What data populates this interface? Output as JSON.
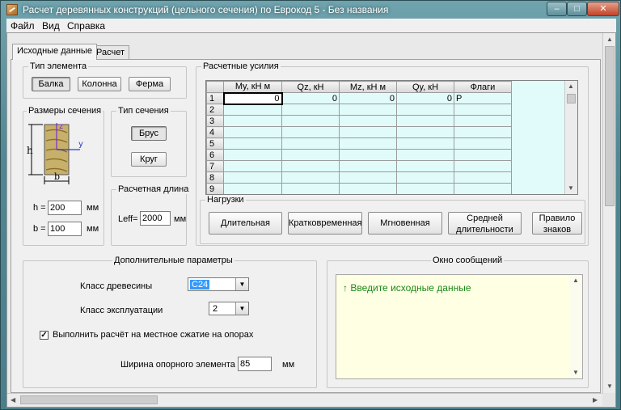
{
  "window": {
    "title": "Расчет деревянных конструкций (цельного сечения) по Еврокод 5 - Без названия",
    "minimize_icon": "minimize-icon",
    "maximize_icon": "maximize-icon",
    "close_icon": "close-icon",
    "minimize_glyph": "–",
    "maximize_glyph": "□",
    "close_glyph": "✕"
  },
  "menu": {
    "items": [
      {
        "label": "Файл"
      },
      {
        "label": "Вид"
      },
      {
        "label": "Справка"
      }
    ]
  },
  "tabs": [
    {
      "label": "Исходные данные",
      "active": true
    },
    {
      "label": "Расчет",
      "active": false
    }
  ],
  "element_type": {
    "legend": "Тип элемента",
    "buttons": [
      "Балка",
      "Колонна",
      "Ферма"
    ],
    "selected": "Балка"
  },
  "section_sizes": {
    "legend": "Размеры сечения",
    "diagram": {
      "h": "h",
      "b": "b",
      "z": "z",
      "y": "y"
    },
    "h_label": "h =",
    "h_value": "200",
    "h_unit": "мм",
    "b_label": "b =",
    "b_value": "100",
    "b_unit": "мм"
  },
  "section_type": {
    "legend": "Тип сечения",
    "buttons": [
      "Брус",
      "Круг"
    ],
    "selected": "Брус"
  },
  "design_length": {
    "legend": "Расчетная длина",
    "label": "Leff=",
    "value": "2000",
    "unit": "мм"
  },
  "forces": {
    "legend": "Расчетные усилия",
    "columns": [
      "My, кН м",
      "Qz, кН",
      "Mz, кН м",
      "Qy, кН",
      "Флаги"
    ],
    "rows": [
      {
        "n": "1",
        "cells": [
          "0",
          "0",
          "0",
          "0",
          "P"
        ]
      },
      {
        "n": "2",
        "cells": [
          "",
          "",
          "",
          "",
          ""
        ]
      },
      {
        "n": "3",
        "cells": [
          "",
          "",
          "",
          "",
          ""
        ]
      },
      {
        "n": "4",
        "cells": [
          "",
          "",
          "",
          "",
          ""
        ]
      },
      {
        "n": "5",
        "cells": [
          "",
          "",
          "",
          "",
          ""
        ]
      },
      {
        "n": "6",
        "cells": [
          "",
          "",
          "",
          "",
          ""
        ]
      },
      {
        "n": "7",
        "cells": [
          "",
          "",
          "",
          "",
          ""
        ]
      },
      {
        "n": "8",
        "cells": [
          "",
          "",
          "",
          "",
          ""
        ]
      },
      {
        "n": "9",
        "cells": [
          "",
          "",
          "",
          "",
          ""
        ]
      }
    ],
    "scroll_up": "▲",
    "scroll_down": "▼"
  },
  "loads": {
    "legend": "Нагрузки",
    "buttons": [
      {
        "label": "Длительная"
      },
      {
        "label": "Кратковременная"
      },
      {
        "label": "Мгновенная"
      },
      {
        "label": "Средней длительности"
      },
      {
        "label": "Правило знаков"
      }
    ]
  },
  "additional": {
    "legend": "Дополнительные параметры",
    "wood_class_label": "Класс древесины",
    "wood_class_value": "C24",
    "service_class_label": "Класс эксплуатации",
    "service_class_value": "2",
    "check_label": "Выполнить расчёт на местное сжатие на опорах",
    "check_mark": "✓",
    "checked": true,
    "support_label": "Ширина опорного элемента",
    "support_value": "85",
    "support_unit": "мм",
    "dropdown_glyph": "▼"
  },
  "messages": {
    "legend": "Окно сообщений",
    "text": "↑ Введите исходные данные"
  },
  "scrollbars": {
    "up": "▲",
    "down": "▼",
    "left": "◀",
    "right": "▶"
  }
}
